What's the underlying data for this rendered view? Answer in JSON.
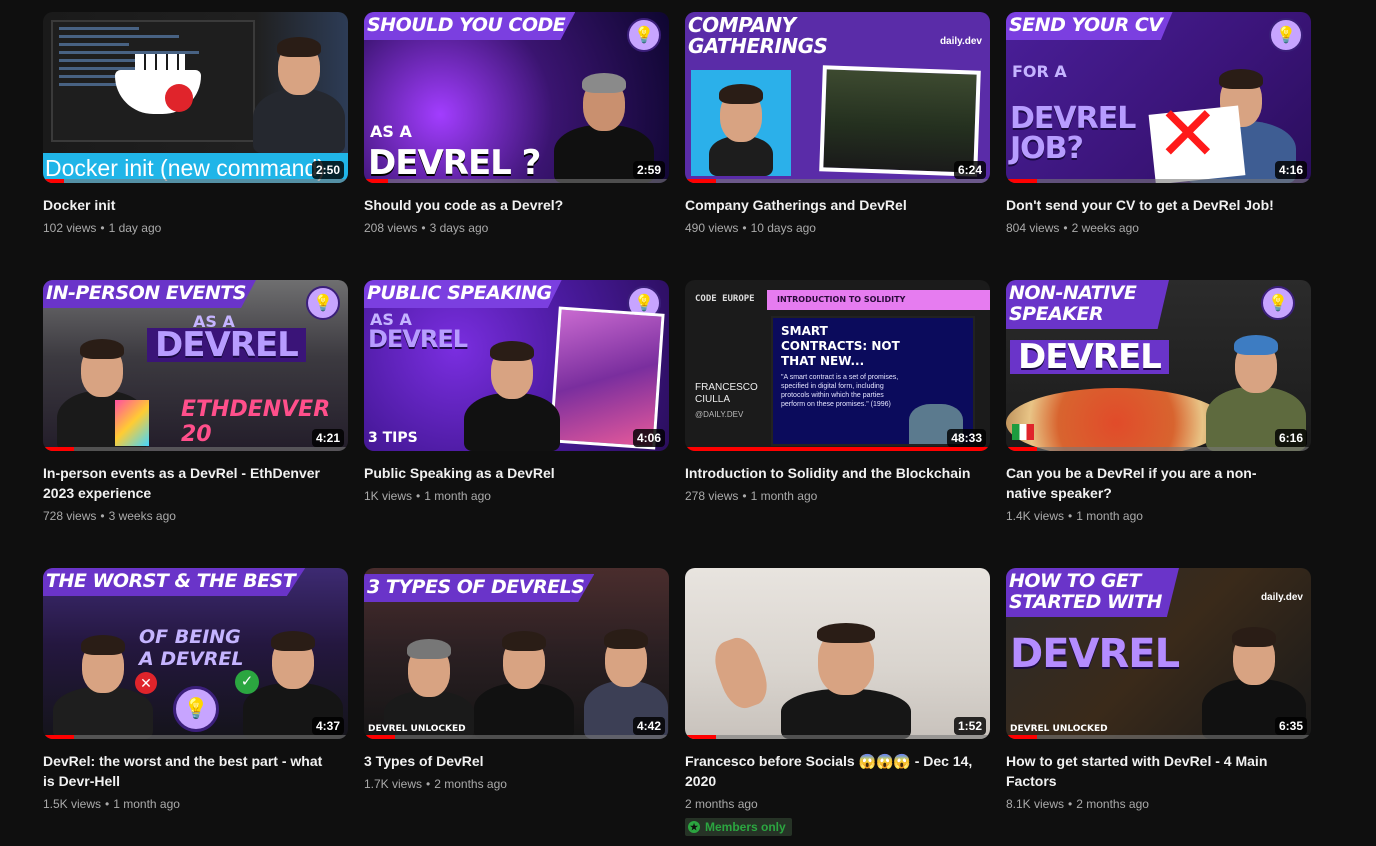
{
  "colors": {
    "background": "#0f0f0f",
    "title_text": "#f1f1f1",
    "meta_text": "#aaaaaa",
    "progress_red": "#ff0000",
    "members_green": "#2ba640",
    "thumb_purple": "#5b2aa6"
  },
  "videos": [
    {
      "title": "Docker init",
      "views": "102 views",
      "age": "1 day ago",
      "duration": "2:50",
      "watched": 0.07,
      "thumb": {
        "caption": "Docker init (new command)"
      }
    },
    {
      "title": "Should you code as a Devrel?",
      "views": "208 views",
      "age": "3 days ago",
      "duration": "2:59",
      "watched": 0.08,
      "thumb": {
        "headline": "SHOULD YOU CODE",
        "sub": "AS A",
        "big": "DEVREL ?"
      }
    },
    {
      "title": "Company Gatherings and DevRel",
      "views": "490 views",
      "age": "10 days ago",
      "duration": "6:24",
      "watched": 0.1,
      "thumb": {
        "headline": "COMPANY GATHERINGS",
        "brand": "daily.dev"
      }
    },
    {
      "title": "Don't send your CV to get a DevRel Job!",
      "views": "804 views",
      "age": "2 weeks ago",
      "duration": "4:16",
      "watched": 0.1,
      "thumb": {
        "headline": "SEND YOUR CV",
        "sub": "FOR A",
        "big": "DEVREL JOB?"
      }
    },
    {
      "title": "In-person events as a DevRel - EthDenver 2023 experience",
      "views": "728 views",
      "age": "3 weeks ago",
      "duration": "4:21",
      "watched": 0.1,
      "thumb": {
        "headline": "IN-PERSON EVENTS",
        "sub": "AS A",
        "big": "DEVREL",
        "tag": "ETHDENVER 20"
      }
    },
    {
      "title": "Public Speaking as a DevRel",
      "views": "1K views",
      "age": "1 month ago",
      "duration": "4:06",
      "watched": 0,
      "thumb": {
        "headline": "PUBLIC SPEAKING",
        "sub": "AS A",
        "big": "DEVREL",
        "tag": "3 TIPS"
      }
    },
    {
      "title": "Introduction to Solidity and the Blockchain",
      "views": "278 views",
      "age": "1 month ago",
      "duration": "48:33",
      "watched": 1.0,
      "thumb": {
        "brand": "CODE EUROPE",
        "banner": "INTRODUCTION TO SOLIDITY",
        "speaker": "FRANCESCO CIULLA",
        "handle": "@DAILY.DEV",
        "slide_title": "SMART CONTRACTS: NOT THAT NEW...",
        "slide_body": "\"A smart contract is a set of promises, specified in digital form, including protocols within which the parties perform on these promises.\" (1996)"
      }
    },
    {
      "title": "Can you be a DevRel if you are a non-native speaker?",
      "views": "1.4K views",
      "age": "1 month ago",
      "duration": "6:16",
      "watched": 0.1,
      "thumb": {
        "headline": "NON-NATIVE SPEAKER",
        "big": "DEVREL"
      }
    },
    {
      "title": "DevRel: the worst and the best part - what is Devr-Hell",
      "views": "1.5K views",
      "age": "1 month ago",
      "duration": "4:37",
      "watched": 0.1,
      "thumb": {
        "headline": "THE WORST & THE BEST",
        "sub": "OF BEING A DEVREL"
      }
    },
    {
      "title": "3 Types of DevRel",
      "views": "1.7K views",
      "age": "2 months ago",
      "duration": "4:42",
      "watched": 0.1,
      "thumb": {
        "headline": "3 TYPES OF DEVRELS",
        "tag": "DEVREL UNLOCKED"
      }
    },
    {
      "title": "Francesco before Socials 😱😱😱 - Dec 14, 2020",
      "views": "",
      "age": "2 months ago",
      "duration": "1:52",
      "watched": 0.1,
      "members_only": "Members only",
      "thumb": {}
    },
    {
      "title": "How to get started with DevRel - 4 Main Factors",
      "views": "8.1K views",
      "age": "2 months ago",
      "duration": "6:35",
      "watched": 0.1,
      "thumb": {
        "headline": "HOW TO GET STARTED WITH",
        "big": "DEVREL",
        "tag": "DEVREL UNLOCKED",
        "brand": "daily.dev"
      }
    }
  ]
}
